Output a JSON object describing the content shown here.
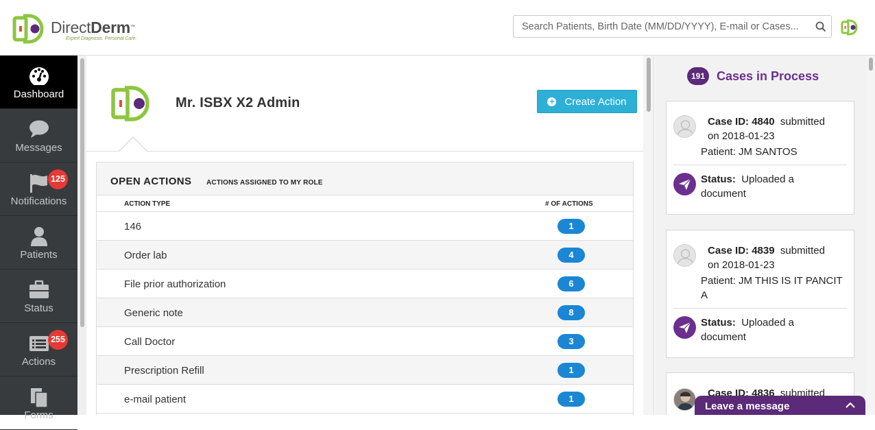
{
  "header": {
    "brand_name_light": "Direct",
    "brand_name_bold": "Derm",
    "brand_tm": "™",
    "brand_tagline": "Expert Diagnosis. Personal Care.",
    "search_placeholder": "Search Patients, Birth Date (MM/DD/YYYY), E-mail or Cases..."
  },
  "sidebar": {
    "items": [
      {
        "label": "Dashboard",
        "icon": "dashboard-gauge-icon",
        "active": true
      },
      {
        "label": "Messages",
        "icon": "chat-bubble-icon"
      },
      {
        "label": "Notifications",
        "icon": "flag-icon",
        "badge": "125"
      },
      {
        "label": "Patients",
        "icon": "person-icon"
      },
      {
        "label": "Status",
        "icon": "briefcase-icon"
      },
      {
        "label": "Actions",
        "icon": "list-card-icon",
        "badge": "255"
      },
      {
        "label": "Forms",
        "icon": "documents-icon"
      }
    ]
  },
  "profile": {
    "name": "Mr. ISBX X2 Admin",
    "create_button": "Create Action"
  },
  "open_actions": {
    "title": "OPEN ACTIONS",
    "subtitle": "ACTIONS ASSIGNED TO MY ROLE",
    "col_type": "ACTION TYPE",
    "col_count": "# OF ACTIONS",
    "rows": [
      {
        "type": "146",
        "count": "1"
      },
      {
        "type": "Order lab",
        "count": "4"
      },
      {
        "type": "File prior authorization",
        "count": "6"
      },
      {
        "type": "Generic note",
        "count": "8"
      },
      {
        "type": "Call Doctor",
        "count": "3"
      },
      {
        "type": "Prescription Refill",
        "count": "1"
      },
      {
        "type": "e-mail patient",
        "count": "1"
      }
    ]
  },
  "cases": {
    "count": "191",
    "title": "Cases in Process",
    "case_id_label": "Case ID:",
    "submitted_word": "submitted",
    "status_label": "Status:",
    "items": [
      {
        "id": "4840",
        "date": "on 2018-01-23",
        "patient": "Patient: JM SANTOS",
        "status": "Uploaded a document"
      },
      {
        "id": "4839",
        "date": "on 2018-01-23",
        "patient": "Patient: JM THIS IS IT PANCIT A",
        "status": "Uploaded a document"
      },
      {
        "id": "4836",
        "date": "",
        "patient": "",
        "status": ""
      }
    ]
  },
  "chat": {
    "label": "Leave a message"
  },
  "colors": {
    "brand_green": "#8dc63f",
    "brand_purple": "#6b2f8e",
    "action_blue": "#2eb0d6",
    "count_blue": "#1a86d4",
    "badge_red": "#e53935",
    "sidebar_bg": "#383b3d"
  }
}
